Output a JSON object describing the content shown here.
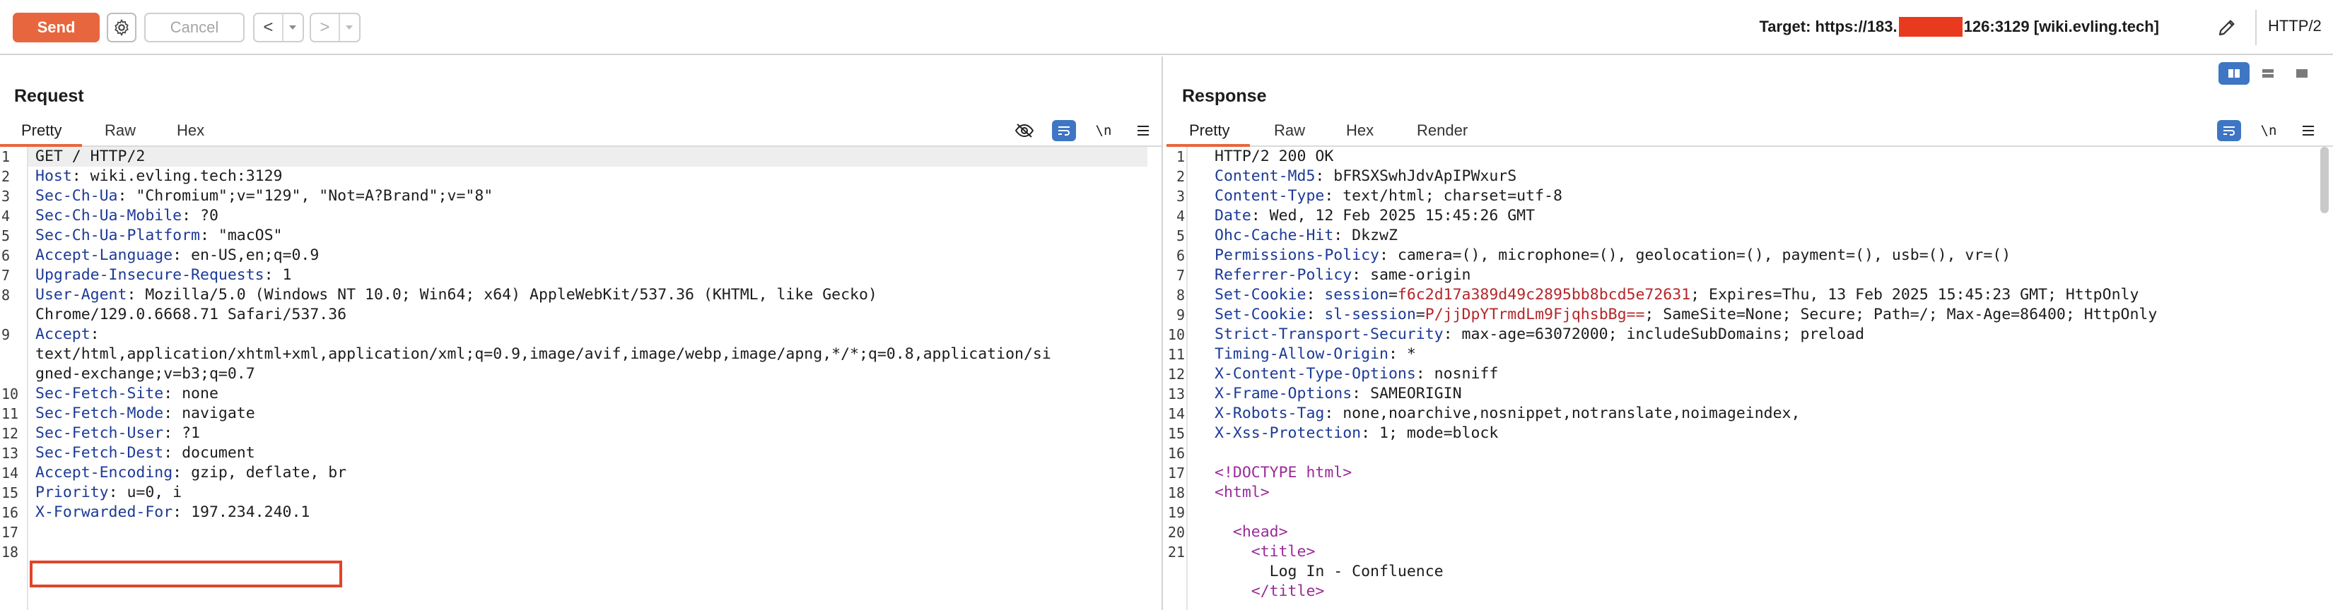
{
  "toolbar": {
    "send_label": "Send",
    "cancel_label": "Cancel",
    "back_label": "<",
    "forward_label": ">",
    "target_prefix": "Target: https://183.",
    "target_suffix": "126:3129 [wiki.evling.tech]",
    "http_version": "HTTP/2"
  },
  "colors": {
    "accent": "#e8663d",
    "header_name": "#1c3a96",
    "header_value": "#1c1c1c",
    "cookie_value": "#b4262a",
    "html_tag": "#9a2a9a",
    "annotation": "#e0442a",
    "toggle_active": "#3f76c4"
  },
  "request": {
    "title": "Request",
    "tabs": [
      "Pretty",
      "Raw",
      "Hex"
    ],
    "active_tab": "Pretty",
    "gutter_numbers": [
      "1",
      "2",
      "3",
      "4",
      "5",
      "6",
      "7",
      "8",
      "",
      "9",
      "",
      "",
      "10",
      "11",
      "12",
      "13",
      "14",
      "15",
      "16",
      "17",
      "18"
    ],
    "lines": [
      {
        "name": "",
        "value": "GET / HTTP/2"
      },
      {
        "name": "Host",
        "value": " wiki.evling.tech:3129"
      },
      {
        "name": "Sec-Ch-Ua",
        "value": " \"Chromium\";v=\"129\", \"Not=A?Brand\";v=\"8\""
      },
      {
        "name": "Sec-Ch-Ua-Mobile",
        "value": " ?0"
      },
      {
        "name": "Sec-Ch-Ua-Platform",
        "value": " \"macOS\""
      },
      {
        "name": "Accept-Language",
        "value": " en-US,en;q=0.9"
      },
      {
        "name": "Upgrade-Insecure-Requests",
        "value": " 1"
      },
      {
        "name": "User-Agent",
        "value": " Mozilla/5.0 (Windows NT 10.0; Win64; x64) AppleWebKit/537.36 (KHTML, like Gecko)"
      },
      {
        "name": "",
        "value": "Chrome/129.0.6668.71 Safari/537.36"
      },
      {
        "name": "Accept",
        "value": ""
      },
      {
        "name": "",
        "value": "text/html,application/xhtml+xml,application/xml;q=0.9,image/avif,image/webp,image/apng,*/*;q=0.8,application/si"
      },
      {
        "name": "",
        "value": "gned-exchange;v=b3;q=0.7"
      },
      {
        "name": "Sec-Fetch-Site",
        "value": " none"
      },
      {
        "name": "Sec-Fetch-Mode",
        "value": " navigate"
      },
      {
        "name": "Sec-Fetch-User",
        "value": " ?1"
      },
      {
        "name": "Sec-Fetch-Dest",
        "value": " document"
      },
      {
        "name": "Accept-Encoding",
        "value": " gzip, deflate, br"
      },
      {
        "name": "Priority",
        "value": " u=0, i"
      },
      {
        "name": "X-Forwarded-For",
        "value": " 197.234.240.1"
      },
      {
        "name": "",
        "value": ""
      },
      {
        "name": "",
        "value": ""
      }
    ]
  },
  "response": {
    "title": "Response",
    "tabs": [
      "Pretty",
      "Raw",
      "Hex",
      "Render"
    ],
    "active_tab": "Pretty",
    "gutter_numbers": [
      "1",
      "2",
      "3",
      "4",
      "5",
      "6",
      "7",
      "8",
      "9",
      "10",
      "11",
      "12",
      "13",
      "14",
      "15",
      "16",
      "17",
      "18",
      "19",
      "20",
      "21",
      ""
    ],
    "lines": [
      {
        "kind": "plain",
        "text": "HTTP/2 200 OK"
      },
      {
        "kind": "header",
        "name": "Content-Md5",
        "value": " bFRSXSwhJdvApIPWxurS"
      },
      {
        "kind": "header",
        "name": "Content-Type",
        "value": " text/html; charset=utf-8"
      },
      {
        "kind": "header",
        "name": "Date",
        "value": " Wed, 12 Feb 2025 15:45:26 GMT"
      },
      {
        "kind": "header",
        "name": "Ohc-Cache-Hit",
        "value": " DkzwZ"
      },
      {
        "kind": "header",
        "name": "Permissions-Policy",
        "value": " camera=(), microphone=(), geolocation=(), payment=(), usb=(), vr=()"
      },
      {
        "kind": "header",
        "name": "Referrer-Policy",
        "value": " same-origin"
      },
      {
        "kind": "cookie",
        "name": "Set-Cookie",
        "cname": " session",
        "cval": "f6c2d17a389d49c2895bb8bcd5e72631",
        "rest": "; Expires=Thu, 13 Feb 2025 15:45:23 GMT; HttpOnly"
      },
      {
        "kind": "cookie",
        "name": "Set-Cookie",
        "cname": " sl-session",
        "cval": "P/jjDpYTrmdLm9FjqhsbBg==",
        "rest": "; SameSite=None; Secure; Path=/; Max-Age=86400; HttpOnly"
      },
      {
        "kind": "header",
        "name": "Strict-Transport-Security",
        "value": " max-age=63072000; includeSubDomains; preload"
      },
      {
        "kind": "header",
        "name": "Timing-Allow-Origin",
        "value": " *"
      },
      {
        "kind": "header",
        "name": "X-Content-Type-Options",
        "value": " nosniff"
      },
      {
        "kind": "header",
        "name": "X-Frame-Options",
        "value": " SAMEORIGIN"
      },
      {
        "kind": "header",
        "name": "X-Robots-Tag",
        "value": " none,noarchive,nosnippet,notranslate,noimageindex,"
      },
      {
        "kind": "header",
        "name": "X-Xss-Protection",
        "value": " 1; mode=block"
      },
      {
        "kind": "plain",
        "text": ""
      },
      {
        "kind": "tag",
        "text": "<!DOCTYPE html>"
      },
      {
        "kind": "tag",
        "text": "<html>"
      },
      {
        "kind": "plain",
        "text": ""
      },
      {
        "kind": "tag",
        "text": "  <head>"
      },
      {
        "kind": "tag",
        "text": "    <title>"
      },
      {
        "kind": "plain",
        "text": "      Log In - Confluence"
      },
      {
        "kind": "tag",
        "text": "    </title>"
      }
    ]
  },
  "icons": {
    "gear": "gear-icon",
    "edit": "pencil-icon",
    "hide": "eye-off-icon",
    "wrap": "wrap-icon",
    "newline": "\\n",
    "menu": "hamburger-icon"
  }
}
